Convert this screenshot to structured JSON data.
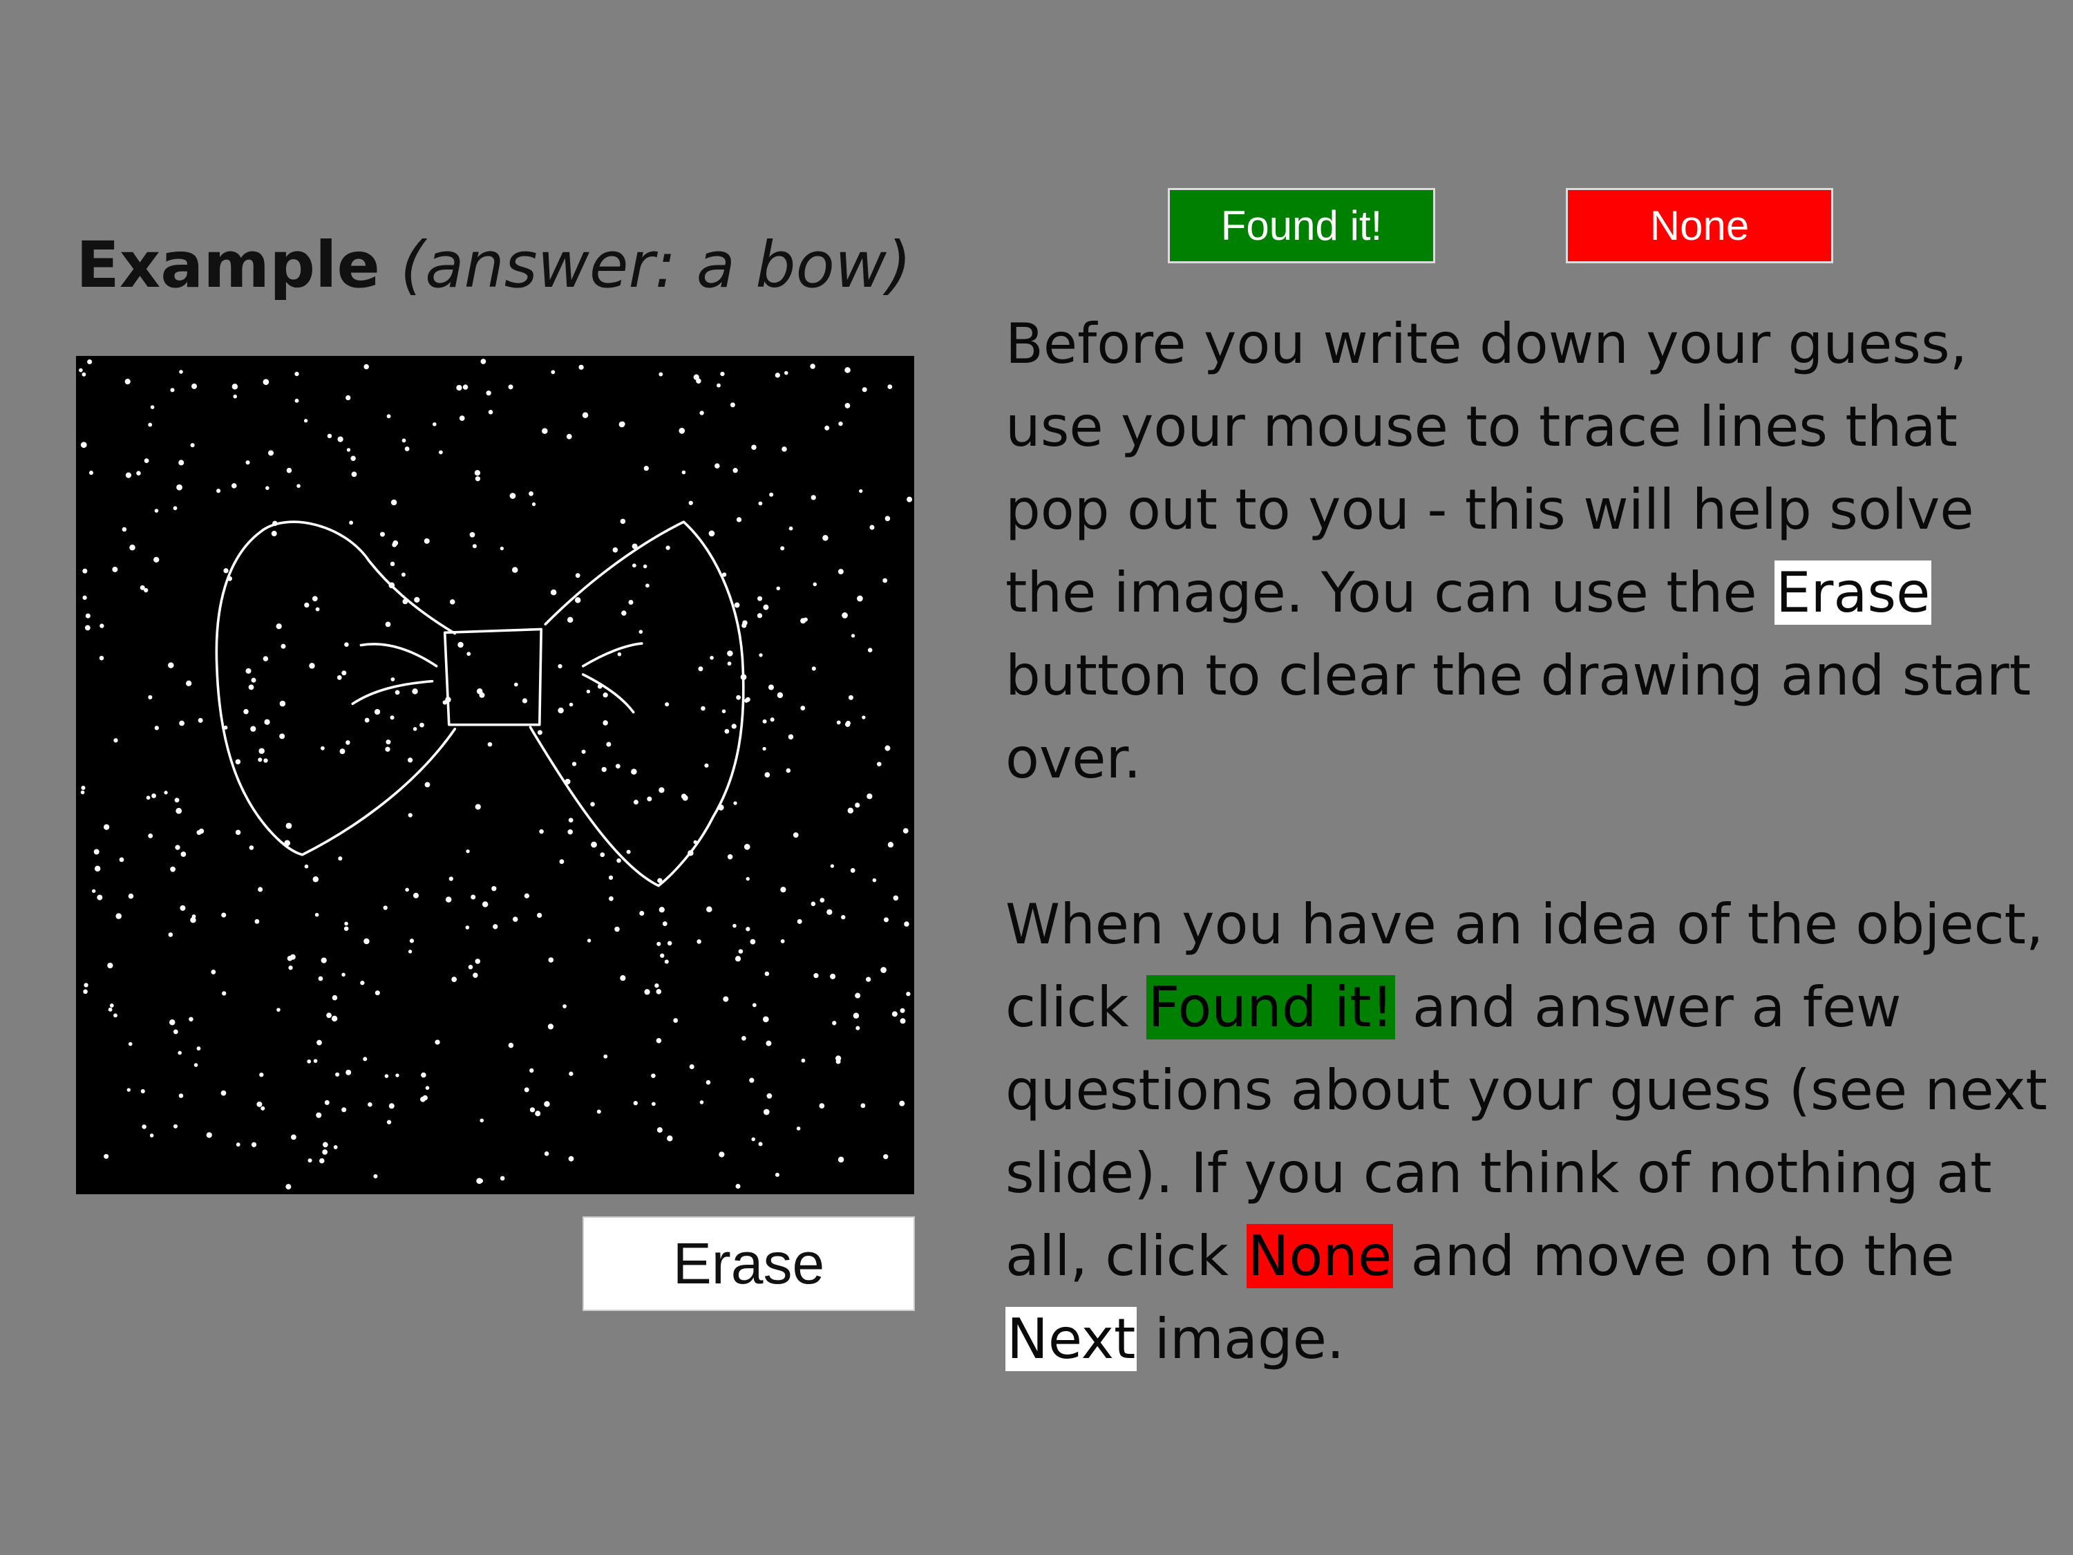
{
  "title": {
    "bold": "Example",
    "italic": "(answer: a bow)"
  },
  "buttons": {
    "erase": "Erase",
    "found": "Found it!",
    "none": "None"
  },
  "colors": {
    "background": "#808080",
    "found": "#008000",
    "none": "#ff0000",
    "stimulus_bg": "#000000"
  },
  "paragraph1": {
    "before": "Before you write down your guess, use your mouse to trace lines that pop out to you - this will help solve the image. You can use the ",
    "erase": "Erase",
    "after": " button to clear the drawing and start over."
  },
  "paragraph2": {
    "p1": "When you have an idea of the object, click ",
    "found": "Found it!",
    "p2": " and answer a few questions about your guess (see next slide). If you can think of nothing at all, click ",
    "none": "None",
    "p3": " and move on to the ",
    "next": "Next",
    "p4": " image."
  }
}
